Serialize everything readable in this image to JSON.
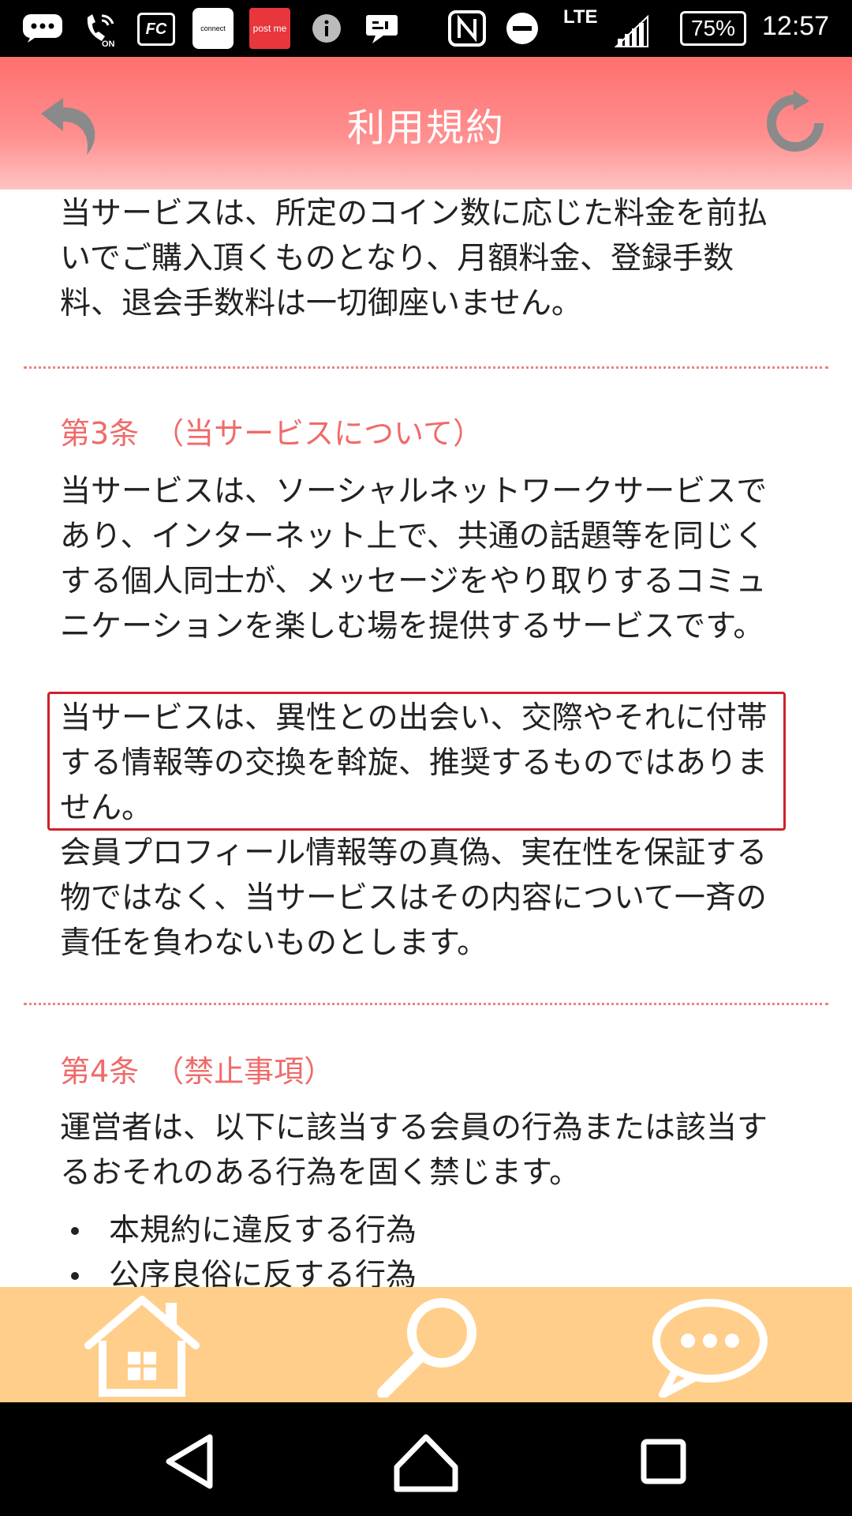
{
  "status_bar": {
    "notification_icons": [
      "chat-bubble-icon",
      "wifi-calling-icon",
      "fc-app-icon",
      "connect-app-icon",
      "post-me-app-icon",
      "info-icon",
      "message-icon"
    ],
    "app_labels": {
      "fc": "FC",
      "connect": "connect",
      "post_me": "post me",
      "wifi_on": "ON"
    },
    "network": "LTE",
    "battery": "75%",
    "time": "12:57"
  },
  "header": {
    "title": "利用規約",
    "back_icon": "back-arrow-icon",
    "reload_icon": "reload-icon"
  },
  "content": {
    "intro_paragraph": "当サービスは、所定のコイン数に応じた料金を前払いでご購入頂くものとなり、月額料金、登録手数料、退会手数料は一切御座いません。",
    "article3": {
      "title": "第3条　（当サービスについて）",
      "paragraph1": "当サービスは、ソーシャルネットワークサービスであり、インターネット上で、共通の話題等を同じくする個人同士が、メッセージをやり取りするコミュニケーションを楽しむ場を提供するサービスです。",
      "paragraph2_highlighted": "当サービスは、異性との出会い、交際やそれに付帯する情報等の交換を斡旋、推奨するものではありません。",
      "paragraph3": "会員プロフィール情報等の真偽、実在性を保証する物ではなく、当サービスはその内容について一斉の責任を負わないものとします。"
    },
    "article4": {
      "title": "第4条　（禁止事項）",
      "paragraph1": "運営者は、以下に該当する会員の行為または該当するおそれのある行為を固く禁じます。",
      "bullets": [
        "本規約に違反する行為",
        "公序良俗に反する行為"
      ]
    }
  },
  "bottom_nav": {
    "items": [
      "home-icon",
      "search-icon",
      "chat-icon"
    ],
    "background_color": "#ffce8a"
  },
  "colors": {
    "header_top": "#ff6f6f",
    "article_title": "#f06a6a",
    "highlight_border": "#d0202a"
  }
}
